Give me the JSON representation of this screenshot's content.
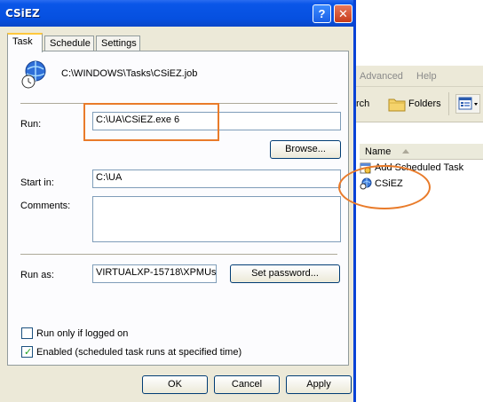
{
  "explorer": {
    "menu": [
      "Advanced",
      "Help"
    ],
    "toolbar": {
      "search_fragment": "rch",
      "folders": "Folders"
    },
    "list_header": "Name",
    "items": [
      "Add Scheduled Task",
      "CSiEZ"
    ]
  },
  "dialog": {
    "title": "CSiEZ",
    "title_help": "?",
    "title_close": "✕",
    "tabs": [
      "Task",
      "Schedule",
      "Settings"
    ],
    "job_path": "C:\\WINDOWS\\Tasks\\CSiEZ.job",
    "run": {
      "label": "Run:",
      "value": "C:\\UA\\CSiEZ.exe 6",
      "browse": "Browse..."
    },
    "start_in": {
      "label": "Start in:",
      "value": "C:\\UA"
    },
    "comments": {
      "label": "Comments:",
      "value": ""
    },
    "run_as": {
      "label": "Run as:",
      "value": "VIRTUALXP-15718\\XPMUs",
      "set_password": "Set password..."
    },
    "options": [
      {
        "label": "Run only if logged on",
        "checked": false
      },
      {
        "label": "Enabled (scheduled task runs at specified time)",
        "checked": true
      }
    ],
    "buttons": {
      "ok": "OK",
      "cancel": "Cancel",
      "apply": "Apply"
    }
  },
  "colors": {
    "title_blue": "#0650e0",
    "annotation_orange": "#e97b2a",
    "dialog_bg": "#ece9d8"
  }
}
